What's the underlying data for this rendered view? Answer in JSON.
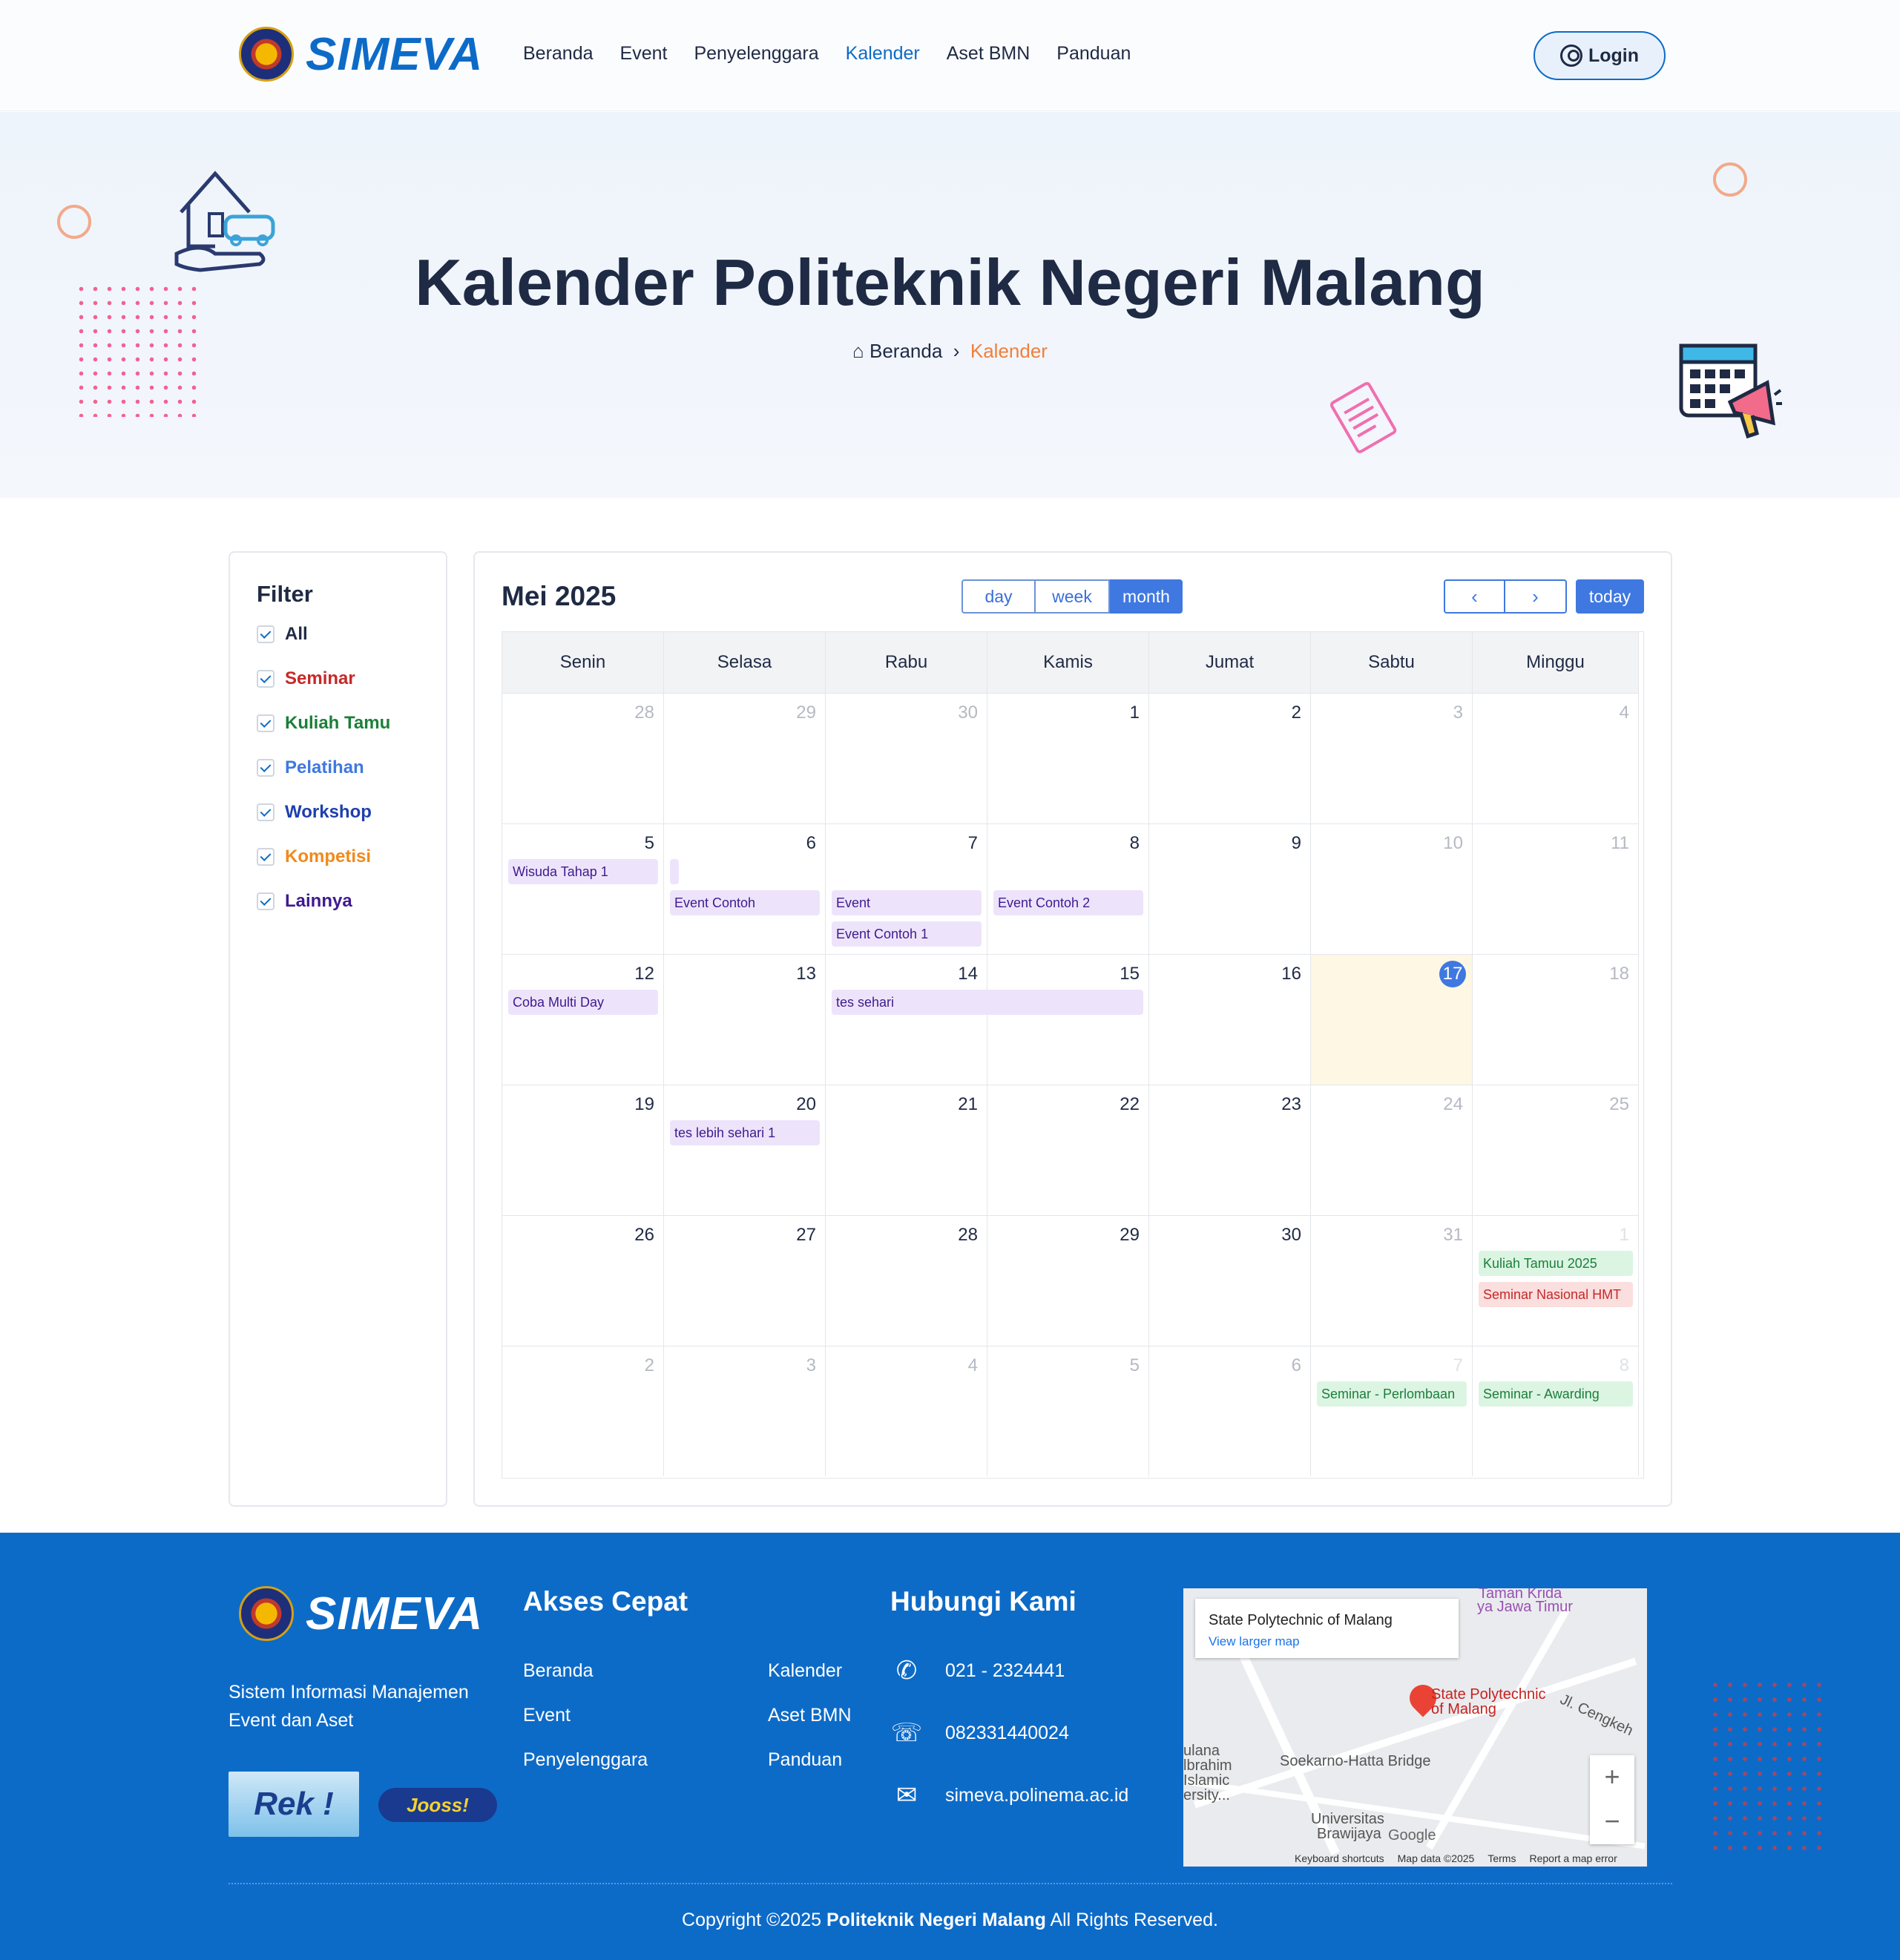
{
  "header": {
    "brand": "SIMEVA",
    "nav": [
      "Beranda",
      "Event",
      "Penyelenggara",
      "Kalender",
      "Aset BMN",
      "Panduan"
    ],
    "active_nav": "Kalender",
    "login_label": "Login"
  },
  "hero": {
    "title": "Kalender Politeknik Negeri Malang",
    "breadcrumb_home": "Beranda",
    "breadcrumb_current": "Kalender"
  },
  "filter": {
    "title": "Filter",
    "items": [
      {
        "label": "All",
        "color": "#1f2a44",
        "checked": true
      },
      {
        "label": "Seminar",
        "color": "#c62828",
        "checked": true
      },
      {
        "label": "Kuliah Tamu",
        "color": "#1b7f3a",
        "checked": true
      },
      {
        "label": "Pelatihan",
        "color": "#3f78e0",
        "checked": true
      },
      {
        "label": "Workshop",
        "color": "#1e3fae",
        "checked": true
      },
      {
        "label": "Kompetisi",
        "color": "#f08a1c",
        "checked": true
      },
      {
        "label": "Lainnya",
        "color": "#3f1a8f",
        "checked": true
      }
    ]
  },
  "calendar": {
    "title": "Mei 2025",
    "views": [
      "day",
      "week",
      "month"
    ],
    "active_view": "month",
    "prev_icon": "chevron-left-icon",
    "next_icon": "chevron-right-icon",
    "today_label": "today",
    "weekdays": [
      "Senin",
      "Selasa",
      "Rabu",
      "Kamis",
      "Jumat",
      "Sabtu",
      "Minggu"
    ],
    "weeks": [
      [
        "28",
        "29",
        "30",
        "1",
        "2",
        "3",
        "4"
      ],
      [
        "5",
        "6",
        "7",
        "8",
        "9",
        "10",
        "11"
      ],
      [
        "12",
        "13",
        "14",
        "15",
        "16",
        "17",
        "18"
      ],
      [
        "19",
        "20",
        "21",
        "22",
        "23",
        "24",
        "25"
      ],
      [
        "26",
        "27",
        "28",
        "29",
        "30",
        "31",
        "1"
      ],
      [
        "2",
        "3",
        "4",
        "5",
        "6",
        "7",
        "8"
      ]
    ],
    "today_date": "17",
    "events": [
      {
        "title": "Wisuda Tahap 1",
        "week": 1,
        "day": 0,
        "span": 1,
        "slot": 0,
        "category": "Lainnya"
      },
      {
        "title": "",
        "week": 1,
        "day": 1,
        "span": 1,
        "slot": 0,
        "category": "Lainnya"
      },
      {
        "title": "Event Contoh",
        "week": 1,
        "day": 1,
        "span": 1,
        "slot": 1,
        "category": "Lainnya"
      },
      {
        "title": "Event",
        "week": 1,
        "day": 2,
        "span": 1,
        "slot": 1,
        "category": "Lainnya"
      },
      {
        "title": "Event Contoh 1",
        "week": 1,
        "day": 2,
        "span": 1,
        "slot": 2,
        "category": "Lainnya"
      },
      {
        "title": "Event Contoh 2",
        "week": 1,
        "day": 3,
        "span": 1,
        "slot": 1,
        "category": "Lainnya"
      },
      {
        "title": "Coba Multi Day",
        "week": 2,
        "day": 0,
        "span": 1,
        "slot": 0,
        "category": "Lainnya"
      },
      {
        "title": "tes sehari",
        "week": 2,
        "day": 2,
        "span": 2,
        "slot": 0,
        "category": "Lainnya"
      },
      {
        "title": "tes lebih sehari 1",
        "week": 3,
        "day": 1,
        "span": 1,
        "slot": 0,
        "category": "Lainnya"
      },
      {
        "title": "Kuliah Tamuu 2025",
        "week": 4,
        "day": 6,
        "span": 1,
        "slot": 0,
        "category": "Kuliah Tamu"
      },
      {
        "title": "Seminar Nasional HMT",
        "week": 4,
        "day": 6,
        "span": 1,
        "slot": 1,
        "category": "Seminar"
      },
      {
        "title": "Seminar - Perlombaan",
        "week": 5,
        "day": 5,
        "span": 1,
        "slot": 0,
        "category": "Kuliah Tamu"
      },
      {
        "title": "Seminar - Awarding",
        "week": 5,
        "day": 6,
        "span": 1,
        "slot": 0,
        "category": "Kuliah Tamu"
      }
    ],
    "category_colors": {
      "Lainnya": {
        "bg": "#ede4fb",
        "text": "#3f1a8f"
      },
      "Kuliah Tamu": {
        "bg": "#dcf5e3",
        "text": "#1b7f3a"
      },
      "Seminar": {
        "bg": "#fbdede",
        "text": "#c62828"
      }
    }
  },
  "footer": {
    "brand": "SIMEVA",
    "description": "Sistem Informasi Manajemen Event dan Aset",
    "quick_links_title": "Akses Cepat",
    "quick_links_col1": [
      "Beranda",
      "Event",
      "Penyelenggara"
    ],
    "quick_links_col2": [
      "Kalender",
      "Aset BMN",
      "Panduan"
    ],
    "contact_title": "Hubungi Kami",
    "contacts": [
      {
        "icon": "phone-icon",
        "text": "021 - 2324441"
      },
      {
        "icon": "whatsapp-icon",
        "text": "082331440024"
      },
      {
        "icon": "envelope-icon",
        "text": "simeva.polinema.ac.id"
      }
    ],
    "partner1": "Rek !",
    "partner2": "Jooss!",
    "map": {
      "place": "State Polytechnic of Malang",
      "larger_map": "View larger map",
      "pin_label_1": "State Polytechnic",
      "pin_label_2": "of Malang",
      "labels": [
        "Soekarno-Hatta Bridge",
        "Universitas",
        "Brawijaya",
        "Jl. Cengkeh",
        "Taman Krida",
        "ya Jawa Timur",
        "ulana",
        "lbrahim",
        "Islamic",
        "ersity..."
      ],
      "footer": [
        "Keyboard shortcuts",
        "Map data ©2025",
        "Terms",
        "Report a map error"
      ],
      "google": "Google"
    },
    "copyright_prefix": "Copyright ©2025 ",
    "copyright_org": "Politeknik Negeri Malang",
    "copyright_suffix": " All Rights Reserved."
  }
}
